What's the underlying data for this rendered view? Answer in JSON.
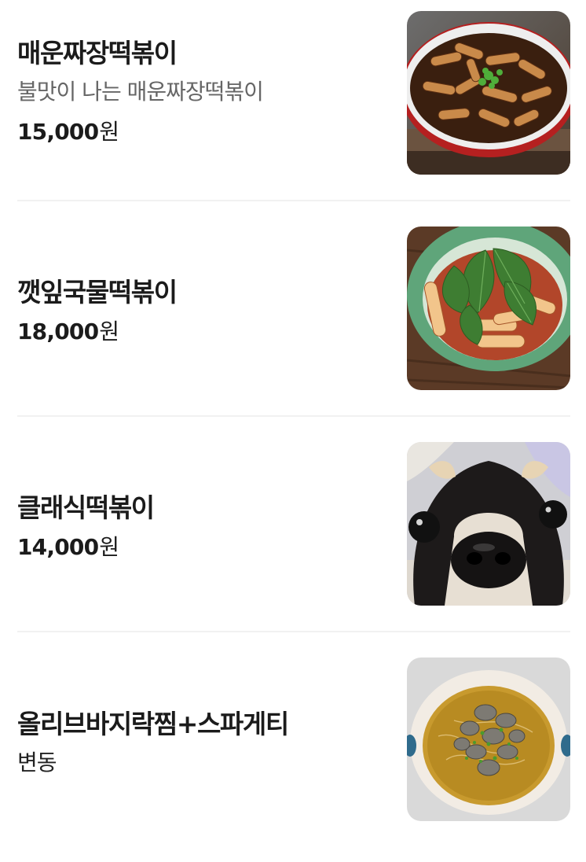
{
  "menu": {
    "items": [
      {
        "name": "매운짜장떡볶이",
        "description": "불맛이 나는 매운짜장떡볶이",
        "price": "15,000",
        "currency": "원",
        "image_icon": "jjajang-tteokbokki-photo"
      },
      {
        "name": "깻잎국물떡볶이",
        "price": "18,000",
        "currency": "원",
        "image_icon": "perilla-soup-tteokbokki-photo"
      },
      {
        "name": "클래식떡볶이",
        "price": "14,000",
        "currency": "원",
        "image_icon": "dog-photo"
      },
      {
        "name": "올리브바지락찜+스파게티",
        "price_note": "변동",
        "image_icon": "clam-spaghetti-photo"
      }
    ]
  },
  "colors": {
    "text_primary": "#1b1b1b",
    "text_secondary": "#666666",
    "divider": "#f1f1f1",
    "background": "#ffffff"
  }
}
